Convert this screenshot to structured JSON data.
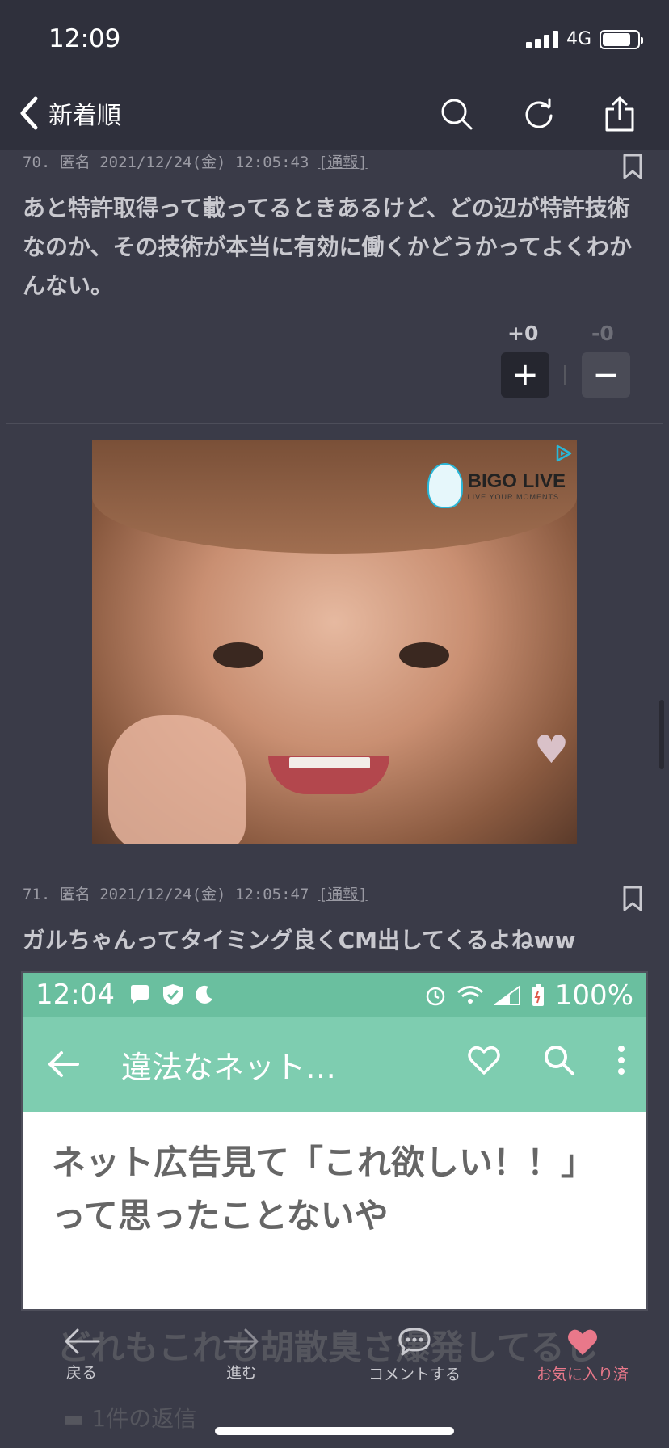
{
  "status_bar": {
    "time": "12:09",
    "network": "4G"
  },
  "nav": {
    "back_label": "新着順"
  },
  "posts": [
    {
      "meta_prefix": "70. 匿名 2021/12/24(金) 12:05:43 ",
      "report": "[通報]",
      "body": "あと特許取得って載ってるときあるけど、どの辺が特許技術なのか、その技術が本当に有効に働くかどうかってよくわかんない。",
      "plus_count": "+0",
      "minus_count": "-0"
    },
    {
      "meta_prefix": "71. 匿名 2021/12/24(金) 12:05:47 ",
      "report": "[通報]",
      "body": "ガルちゃんってタイミング良くCM出してくるよねww"
    }
  ],
  "ad": {
    "brand": "BIGO LIVE",
    "tagline": "LIVE YOUR MOMENTS"
  },
  "embed": {
    "time": "12:04",
    "battery": "100%",
    "title": "違法なネット…",
    "content_line1": "ネット広告見て「これ欲しい！！」",
    "content_line2": "って思ったことないや"
  },
  "toolbar": {
    "back_label": "戻る",
    "forward_label": "進む",
    "comment_label": "コメントする",
    "favorite_label": "お気に入り済",
    "ghost_text": "どれもこれも胡散臭さ爆発してるし",
    "ghost_reply": "1件の返信"
  },
  "colors": {
    "background": "#3a3b48",
    "bar": "#2f303c",
    "favorite": "#e9788a",
    "embed_accent": "#7ecdb0"
  }
}
